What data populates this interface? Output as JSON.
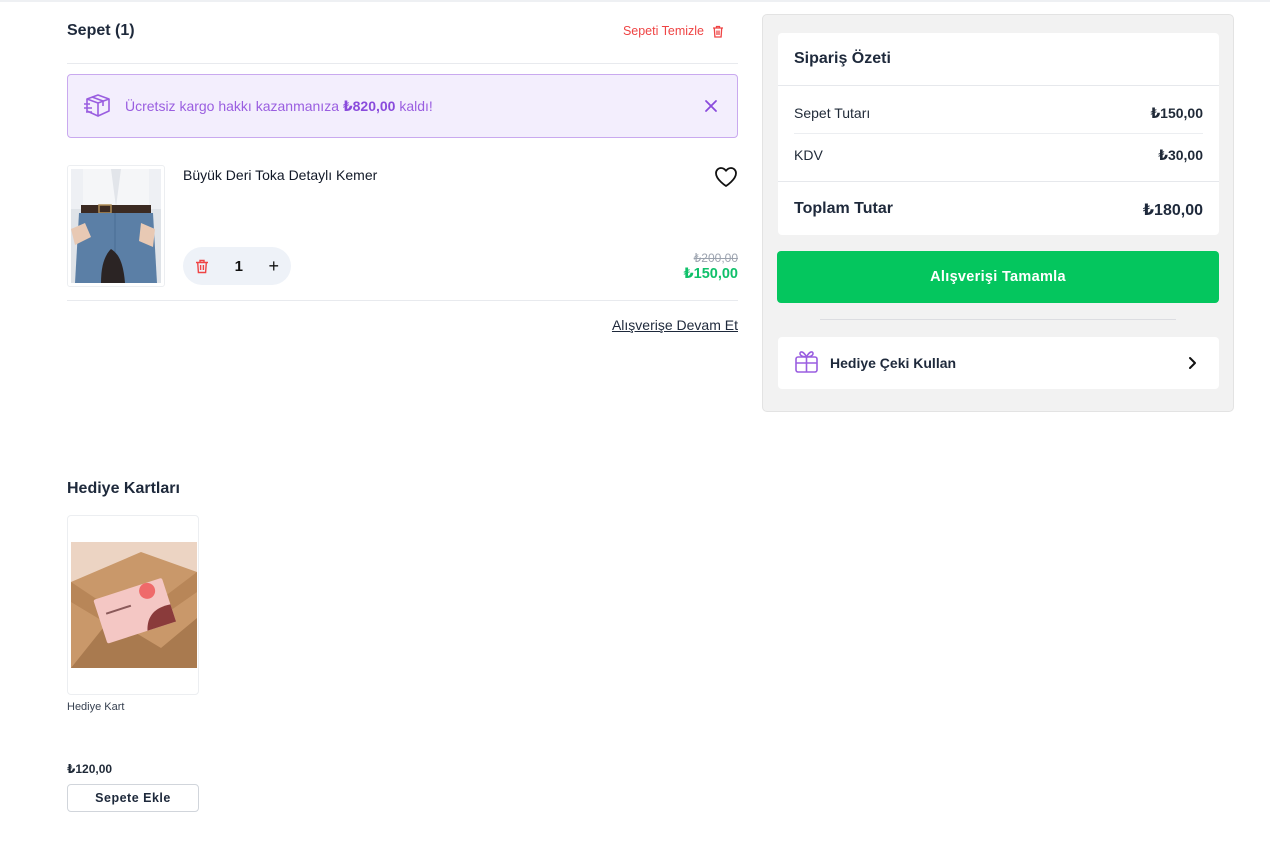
{
  "cart": {
    "title": "Sepet (1)",
    "clear_label": "Sepeti Temizle"
  },
  "shipping": {
    "prefix": "Ücretsiz kargo hakkı kazanmanıza ",
    "amount": "₺820,00",
    "suffix": " kaldı!"
  },
  "product": {
    "name": "Büyük Deri Toka Detaylı Kemer",
    "quantity": "1",
    "plus": "+",
    "old_price": "₺200,00",
    "new_price": "₺150,00"
  },
  "continue_label": "Alışverişe Devam Et",
  "gift_cards": {
    "title": "Hediye Kartları",
    "items": [
      {
        "name": "Hediye Kart",
        "price": "₺120,00",
        "add_label": "Sepete Ekle"
      }
    ]
  },
  "summary": {
    "title": "Sipariş Özeti",
    "rows": [
      {
        "label": "Sepet Tutarı",
        "value": "₺150,00"
      },
      {
        "label": "KDV",
        "value": "₺30,00"
      }
    ],
    "total_label": "Toplam Tutar",
    "total_value": "₺180,00",
    "checkout_label": "Alışverişi Tamamla",
    "gift_code_label": "Hediye Çeki Kullan"
  },
  "colors": {
    "accent_purple": "#8a4bdc",
    "success_green": "#04c65e",
    "danger_red": "#ef4444"
  },
  "icons": [
    "trash-icon",
    "shipping-box-icon",
    "close-icon",
    "heart-icon",
    "gift-icon",
    "chevron-right-icon"
  ]
}
